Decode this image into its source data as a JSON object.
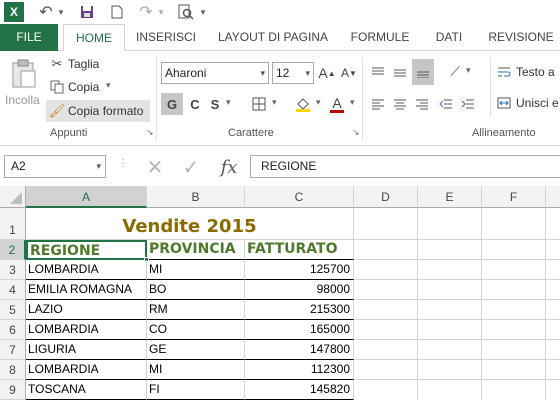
{
  "qat": {
    "excel_icon": "X",
    "undo": "↶",
    "redo": "↷",
    "more": "▾"
  },
  "tabs": [
    "FILE",
    "HOME",
    "INSERISCI",
    "LAYOUT DI PAGINA",
    "FORMULE",
    "DATI",
    "REVISIONE"
  ],
  "ribbon": {
    "clipboard": {
      "paste_label": "Incolla",
      "cut_label": "Taglia",
      "copy_label": "Copia",
      "format_painter_label": "Copia formato",
      "group_label": "Appunti"
    },
    "font": {
      "font_name": "Aharoni",
      "font_size": "12",
      "bold": "G",
      "italic": "C",
      "underline": "S",
      "group_label": "Carattere"
    },
    "alignment": {
      "wrap_text": "Testo a",
      "merge": "Unisci e",
      "group_label": "Allineamento"
    }
  },
  "formula_bar": {
    "name_box": "A2",
    "fx": "fx",
    "content": "REGIONE"
  },
  "sheet": {
    "columns": [
      "A",
      "B",
      "C",
      "D",
      "E",
      "F"
    ],
    "rows": [
      "1",
      "2",
      "3",
      "4",
      "5",
      "6",
      "7",
      "8",
      "9"
    ],
    "title": "Vendite 2015",
    "headers": [
      "REGIONE",
      "PROVINCIA",
      "FATTURATO"
    ],
    "data": [
      [
        "LOMBARDIA",
        "MI",
        "125700"
      ],
      [
        "EMILIA ROMAGNA",
        "BO",
        "98000"
      ],
      [
        "LAZIO",
        "RM",
        "215300"
      ],
      [
        "LOMBARDIA",
        "CO",
        "165000"
      ],
      [
        "LIGURIA",
        "GE",
        "147800"
      ],
      [
        "LOMBARDIA",
        "MI",
        "112300"
      ],
      [
        "TOSCANA",
        "FI",
        "145820"
      ]
    ]
  },
  "colors": {
    "accent": "#217346",
    "title": "#8c6a00",
    "header_text": "#4e7a2c"
  }
}
